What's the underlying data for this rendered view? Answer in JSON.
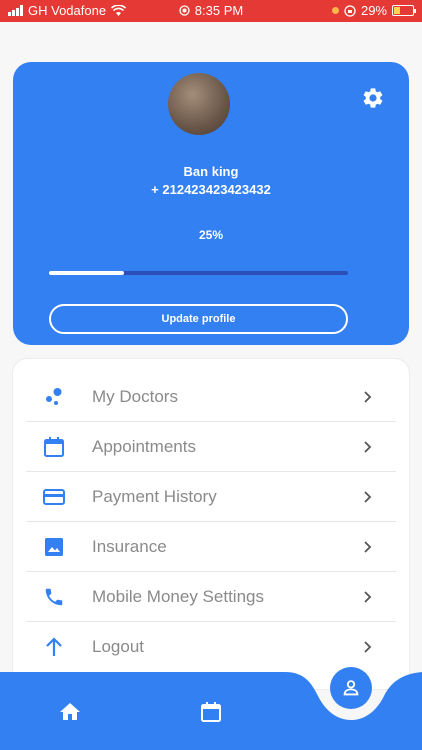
{
  "status_bar": {
    "carrier": "GH Vodafone",
    "time": "8:35 PM",
    "battery": "29%"
  },
  "profile": {
    "name": "Ban king",
    "phone": "+ 212423423423432",
    "completion_label": "25%",
    "completion": 0.25,
    "update_button": "Update profile"
  },
  "menu": {
    "items": [
      {
        "label": "My Doctors",
        "icon": "doctors-icon"
      },
      {
        "label": "Appointments",
        "icon": "calendar-icon"
      },
      {
        "label": "Payment History",
        "icon": "credit-card-icon"
      },
      {
        "label": "Insurance",
        "icon": "image-icon"
      },
      {
        "label": "Mobile Money Settings",
        "icon": "phone-icon"
      },
      {
        "label": "Logout",
        "icon": "arrow-up-icon"
      }
    ]
  },
  "colors": {
    "accent": "#3380f2",
    "status_bar": "#e53935"
  }
}
